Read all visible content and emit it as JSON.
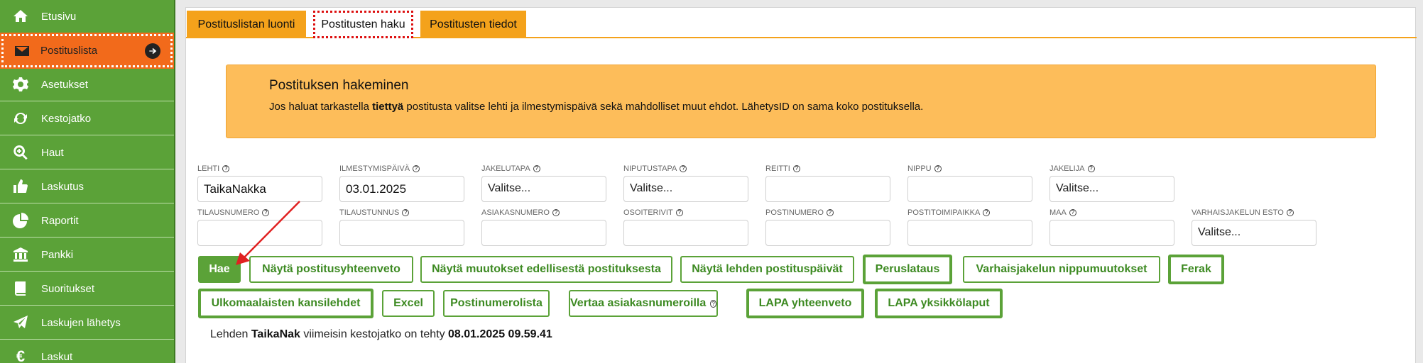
{
  "sidebar": {
    "items": [
      {
        "label": "Etusivu",
        "icon": "home-icon"
      },
      {
        "label": "Postituslista",
        "icon": "envelope-icon",
        "active": true
      },
      {
        "label": "Asetukset",
        "icon": "gear-icon"
      },
      {
        "label": "Kestojatko",
        "icon": "refresh-icon"
      },
      {
        "label": "Haut",
        "icon": "zoom-in-icon"
      },
      {
        "label": "Laskutus",
        "icon": "thumbs-up-icon"
      },
      {
        "label": "Raportit",
        "icon": "pie-chart-icon"
      },
      {
        "label": "Pankki",
        "icon": "bank-icon"
      },
      {
        "label": "Suoritukset",
        "icon": "book-icon"
      },
      {
        "label": "Laskujen lähetys",
        "icon": "paper-plane-icon"
      },
      {
        "label": "Laskut",
        "icon": "euro-icon"
      }
    ]
  },
  "tabs": [
    {
      "label": "Postituslistan luonti"
    },
    {
      "label": "Postitusten haku",
      "active": true
    },
    {
      "label": "Postitusten tiedot"
    }
  ],
  "notice": {
    "title": "Postituksen hakeminen",
    "text_before": "Jos haluat tarkastella ",
    "text_bold": "tiettyä",
    "text_after": " postitusta valitse lehti ja ilmestymispäivä sekä mahdolliset muut ehdot. LähetysID on sama koko postituksella."
  },
  "fields_row1": [
    {
      "label": "LEHTI",
      "value": "TaikaNakka"
    },
    {
      "label": "ILMESTYMISPÄIVÄ",
      "value": "03.01.2025"
    },
    {
      "label": "JAKELUTAPA",
      "value": "Valitse..."
    },
    {
      "label": "NIPUTUSTAPA",
      "value": "Valitse..."
    },
    {
      "label": "REITTI",
      "value": ""
    },
    {
      "label": "NIPPU",
      "value": ""
    },
    {
      "label": "JAKELIJA",
      "value": "Valitse..."
    }
  ],
  "fields_row2": [
    {
      "label": "TILAUSNUMERO",
      "value": ""
    },
    {
      "label": "TILAUSTUNNUS",
      "value": ""
    },
    {
      "label": "ASIAKASNUMERO",
      "value": ""
    },
    {
      "label": "OSOITERIVIT",
      "value": ""
    },
    {
      "label": "POSTINUMERO",
      "value": ""
    },
    {
      "label": "POSTITOIMIPAIKKA",
      "value": ""
    },
    {
      "label": "MAA",
      "value": ""
    },
    {
      "label": "VARHAISJAKELUN ESTO",
      "value": "Valitse..."
    }
  ],
  "buttons_row1": [
    {
      "label": "Hae"
    },
    {
      "label": "Näytä postitusyhteenveto"
    },
    {
      "label": "Näytä muutokset edellisestä postituksesta"
    },
    {
      "label": "Näytä lehden postituspäivät"
    },
    {
      "label": "Peruslataus"
    },
    {
      "label": "Varhaisjakelun nippumuutokset"
    },
    {
      "label": "Ferak"
    }
  ],
  "buttons_row2": [
    {
      "label": "Ulkomaalaisten kansilehdet"
    },
    {
      "label": "Excel"
    },
    {
      "label": "Postinumerolista"
    },
    {
      "label": "Vertaa asiakasnumeroilla"
    },
    {
      "label": "LAPA yhteenveto"
    },
    {
      "label": "LAPA yksikkölaput"
    }
  ],
  "footer": {
    "prefix": "Lehden ",
    "paper": "TaikaNak",
    "middle": " viimeisin kestojatko on tehty ",
    "datetime": "08.01.2025 09.59.41"
  },
  "help_mark": "?",
  "colors": {
    "sidebar": "#5ba238",
    "active": "#f26a1b",
    "tab": "#f4a21b",
    "notice": "#fdbd5a",
    "annotation_arrow": "#e02020"
  }
}
